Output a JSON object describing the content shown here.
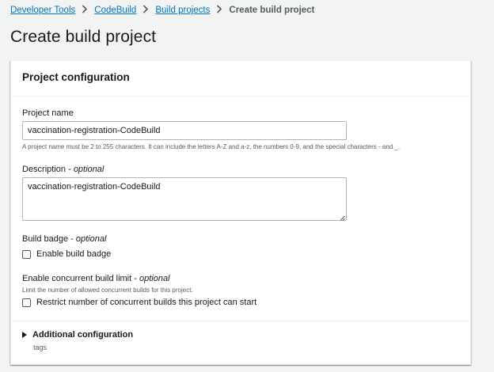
{
  "breadcrumb": {
    "items": [
      {
        "label": "Developer Tools"
      },
      {
        "label": "CodeBuild"
      },
      {
        "label": "Build projects"
      }
    ],
    "current": "Create build project"
  },
  "page": {
    "title": "Create build project"
  },
  "panel": {
    "title": "Project configuration",
    "project_name": {
      "label": "Project name",
      "value": "vaccination-registration-CodeBuild",
      "hint": "A project name must be 2 to 255 characters. It can include the letters A-Z and a-z, the numbers 0-9, and the special characters - and _."
    },
    "description": {
      "label": "Description",
      "optional": "optional",
      "value": "vaccination-registration-CodeBuild"
    },
    "build_badge": {
      "label": "Build badge",
      "optional": "optional",
      "checkbox_label": "Enable build badge",
      "checked": false
    },
    "concurrent_limit": {
      "label": "Enable concurrent build limit",
      "optional": "optional",
      "hint": "Limit the number of allowed concurrent builds for this project.",
      "checkbox_label": "Restrict number of concurrent builds this project can start",
      "checked": false
    },
    "additional": {
      "title": "Additional configuration",
      "subtitle": "tags",
      "expanded": false
    }
  },
  "colors": {
    "link": "#0073bb",
    "background": "#f2f3f3",
    "text": "#16191f",
    "muted": "#545b64",
    "border": "#aab7b8"
  },
  "icons": {
    "separator": "chevron-right-icon",
    "expander": "caret-right-icon"
  }
}
